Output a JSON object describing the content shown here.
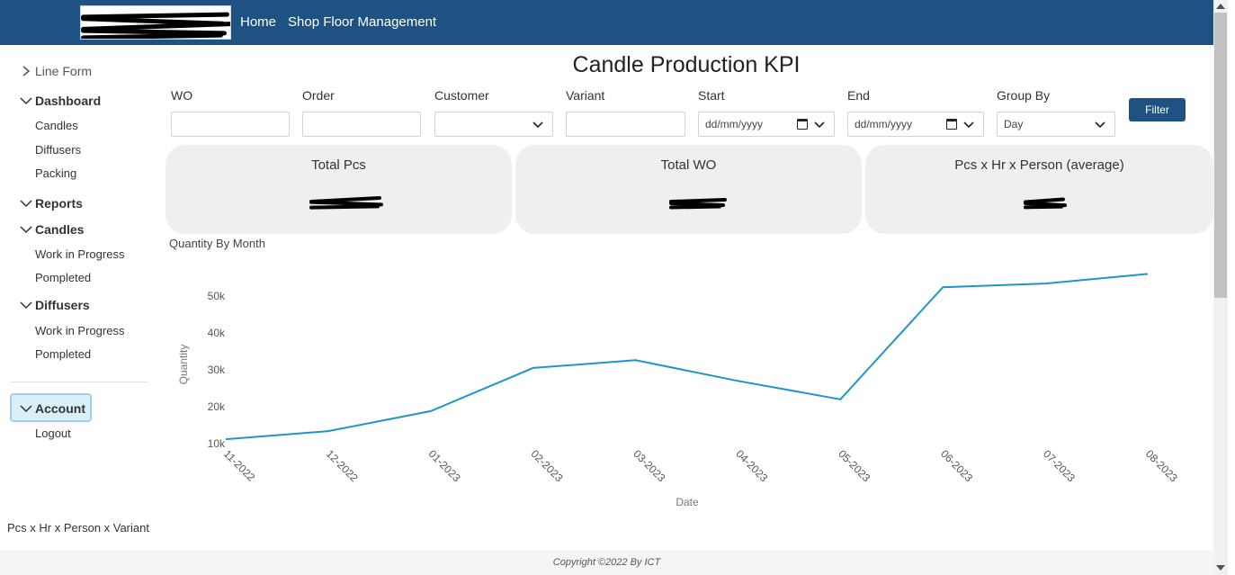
{
  "navbar": {
    "links": [
      "Home",
      "Shop Floor Management"
    ]
  },
  "sidebar": {
    "line_form": "Line Form",
    "dashboard": {
      "label": "Dashboard",
      "items": [
        "Candles",
        "Diffusers",
        "Packing"
      ]
    },
    "reports": "Reports",
    "candles": {
      "label": "Candles",
      "items": [
        "Work in Progress",
        "Pompleted"
      ]
    },
    "diffusers": {
      "label": "Diffusers",
      "items": [
        "Work in Progress",
        "Pompleted"
      ]
    },
    "account": {
      "label": "Account",
      "items": [
        "Logout"
      ]
    },
    "bottom_text": "Pcs x Hr x Person x Variant"
  },
  "page": {
    "title": "Candle Production KPI"
  },
  "filters": {
    "wo": {
      "label": "WO",
      "value": ""
    },
    "order": {
      "label": "Order",
      "value": ""
    },
    "customer": {
      "label": "Customer",
      "value": ""
    },
    "variant": {
      "label": "Variant",
      "value": ""
    },
    "start": {
      "label": "Start",
      "placeholder": "dd/mm/yyyy"
    },
    "end": {
      "label": "End",
      "placeholder": "dd/mm/yyyy"
    },
    "group_by": {
      "label": "Group By",
      "value": "Day"
    },
    "filter_button": "Filter"
  },
  "cards": [
    {
      "title": "Total Pcs"
    },
    {
      "title": "Total WO"
    },
    {
      "title": "Pcs x Hr x Person (average)"
    }
  ],
  "chart_section_label": "Quantity By Month",
  "chart_data": {
    "type": "line",
    "xlabel": "Date",
    "ylabel": "Quantity",
    "categories": [
      "11-2022",
      "12-2022",
      "01-2023",
      "02-2023",
      "03-2023",
      "04-2023",
      "05-2023",
      "06-2023",
      "07-2023",
      "08-2023"
    ],
    "values": [
      11200,
      13400,
      18800,
      30500,
      32600,
      27000,
      22000,
      52400,
      53400,
      56000
    ],
    "yticks": [
      10000,
      20000,
      30000,
      40000,
      50000
    ],
    "ytick_labels": [
      "10k",
      "20k",
      "30k",
      "40k",
      "50k"
    ],
    "ylim": [
      10000,
      60000
    ],
    "line_color": "#1f96c8",
    "grid": false
  },
  "footer": "Copyright ©2022 By ICT"
}
